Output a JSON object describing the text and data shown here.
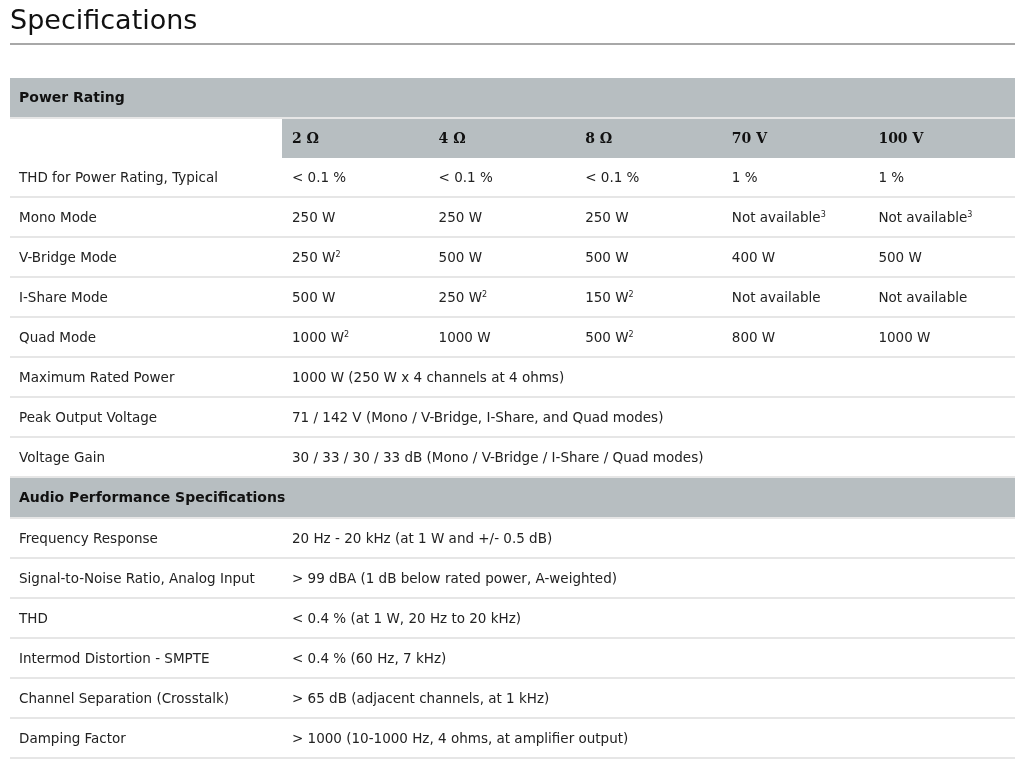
{
  "title": "Specifications",
  "sections": [
    {
      "title": "Power Rating",
      "columns": [
        "2 Ω",
        "4 Ω",
        "8 Ω",
        "70 V",
        "100 V"
      ],
      "rows": [
        {
          "label": "THD for Power Rating, Typical",
          "cells": [
            "< 0.1 %",
            "< 0.1 %",
            "< 0.1 %",
            "1 %",
            "1 %"
          ]
        },
        {
          "label": "Mono Mode",
          "cells": [
            "250 W",
            "250 W",
            "250 W",
            "Not available$^{3}$",
            "Not available$^{3}$"
          ]
        },
        {
          "label": "V-Bridge Mode",
          "cells": [
            "250 W$^{2}$",
            "500 W",
            "500 W",
            "400 W",
            "500 W"
          ]
        },
        {
          "label": "I-Share Mode",
          "cells": [
            "500 W",
            "250 W$^{2}$",
            "150 W$^{2}$",
            "Not available",
            "Not available"
          ]
        },
        {
          "label": "Quad Mode",
          "cells": [
            "1000 W$^{2}$",
            "1000 W",
            "500 W$^{2}$",
            "800 W",
            "1000 W"
          ]
        },
        {
          "label": "Maximum Rated Power",
          "cells": [
            "1000 W (250 W x 4 channels at 4 ohms)"
          ]
        },
        {
          "label": "Peak Output Voltage",
          "cells": [
            "71 / 142 V (Mono / V-Bridge, I-Share, and Quad modes)"
          ]
        },
        {
          "label": "Voltage Gain",
          "cells": [
            "30 / 33 / 30 / 33 dB (Mono / V-Bridge / I-Share / Quad modes)"
          ]
        }
      ]
    },
    {
      "title": "Audio Performance Specifications",
      "rows": [
        {
          "label": "Frequency Response",
          "cells": [
            "20 Hz - 20 kHz (at 1 W and +/- 0.5 dB)"
          ]
        },
        {
          "label": "Signal-to-Noise Ratio, Analog Input",
          "cells": [
            "> 99 dBA (1 dB below rated power, A-weighted)"
          ]
        },
        {
          "label": "THD",
          "cells": [
            "< 0.4 % (at 1 W, 20 Hz to 20 kHz)"
          ]
        },
        {
          "label": "Intermod Distortion - SMPTE",
          "cells": [
            "< 0.4 % (60 Hz, 7 kHz)"
          ]
        },
        {
          "label": "Channel Separation (Crosstalk)",
          "cells": [
            "> 65 dB (adjacent channels, at 1 kHz)"
          ]
        },
        {
          "label": "Damping Factor",
          "cells": [
            "> 1000 (10-1000 Hz, 4 ohms, at amplifier output)"
          ]
        }
      ]
    }
  ]
}
